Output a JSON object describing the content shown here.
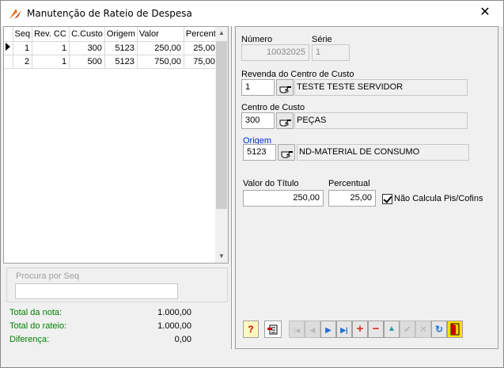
{
  "window": {
    "title": "Manutenção de Rateio de Despesa",
    "close_glyph": "✕"
  },
  "grid": {
    "columns": [
      "Seq",
      "Rev. CC",
      "C.Custo",
      "Origem",
      "Valor",
      "Percent"
    ],
    "rows": [
      {
        "seq": "1",
        "rev": "1",
        "cc": "300",
        "origem": "5123",
        "valor": "250,00",
        "percent": "25,00"
      },
      {
        "seq": "2",
        "rev": "1",
        "cc": "500",
        "origem": "5123",
        "valor": "750,00",
        "percent": "75,00"
      }
    ]
  },
  "search": {
    "label": "Procura por Seq",
    "value": ""
  },
  "totals": [
    {
      "label": "Total da nota:",
      "value": "1.000,00"
    },
    {
      "label": "Total do rateio:",
      "value": "1.000,00"
    },
    {
      "label": "Diferença:",
      "value": "0,00"
    }
  ],
  "form": {
    "numero": {
      "label": "Número",
      "value": "10032025"
    },
    "serie": {
      "label": "Série",
      "value": "1"
    },
    "revenda": {
      "label": "Revenda do Centro de Custo",
      "value": "1",
      "desc": "TESTE TESTE SERVIDOR"
    },
    "centro": {
      "label": "Centro de Custo",
      "value": "300",
      "desc": "PEÇAS"
    },
    "origem": {
      "label": "Origem",
      "value": "5123",
      "desc": "ND-MATERIAL DE CONSUMO"
    },
    "valor_titulo": {
      "label": "Valor do Título",
      "value": "250,00"
    },
    "percentual": {
      "label": "Percentual",
      "value": "25,00"
    },
    "nao_calcula": {
      "label": "Não Calcula Pis/Cofins",
      "checked": true
    }
  },
  "toolbar": {
    "icons": [
      "help-icon",
      "print-icon",
      "first-icon",
      "prior-icon",
      "next-icon",
      "last-icon",
      "insert-icon",
      "delete-icon",
      "edit-icon",
      "post-icon",
      "cancel-icon",
      "refresh-icon",
      "exit-icon"
    ],
    "glyphs": {
      "help": "?",
      "first": "|◀",
      "prior": "◀",
      "next": "▶",
      "last": "▶|",
      "insert": "+",
      "delete": "−",
      "edit": "▲",
      "post": "✔",
      "cancel": "✕",
      "refresh": "↻"
    }
  },
  "colors": {
    "accent_label": "#0033cc",
    "totals_label": "#008000",
    "nav_blue": "#1e6fd9",
    "insert_red": "#e03020"
  }
}
